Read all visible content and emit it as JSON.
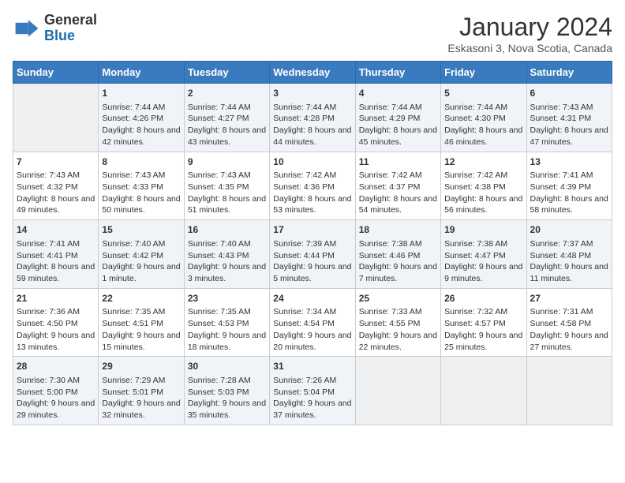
{
  "header": {
    "logo_line1": "General",
    "logo_line2": "Blue",
    "month": "January 2024",
    "location": "Eskasoni 3, Nova Scotia, Canada"
  },
  "days_of_week": [
    "Sunday",
    "Monday",
    "Tuesday",
    "Wednesday",
    "Thursday",
    "Friday",
    "Saturday"
  ],
  "weeks": [
    [
      {
        "day": "",
        "content": ""
      },
      {
        "day": "1",
        "content": "Sunrise: 7:44 AM\nSunset: 4:26 PM\nDaylight: 8 hours and 42 minutes."
      },
      {
        "day": "2",
        "content": "Sunrise: 7:44 AM\nSunset: 4:27 PM\nDaylight: 8 hours and 43 minutes."
      },
      {
        "day": "3",
        "content": "Sunrise: 7:44 AM\nSunset: 4:28 PM\nDaylight: 8 hours and 44 minutes."
      },
      {
        "day": "4",
        "content": "Sunrise: 7:44 AM\nSunset: 4:29 PM\nDaylight: 8 hours and 45 minutes."
      },
      {
        "day": "5",
        "content": "Sunrise: 7:44 AM\nSunset: 4:30 PM\nDaylight: 8 hours and 46 minutes."
      },
      {
        "day": "6",
        "content": "Sunrise: 7:43 AM\nSunset: 4:31 PM\nDaylight: 8 hours and 47 minutes."
      }
    ],
    [
      {
        "day": "7",
        "content": "Sunrise: 7:43 AM\nSunset: 4:32 PM\nDaylight: 8 hours and 49 minutes."
      },
      {
        "day": "8",
        "content": "Sunrise: 7:43 AM\nSunset: 4:33 PM\nDaylight: 8 hours and 50 minutes."
      },
      {
        "day": "9",
        "content": "Sunrise: 7:43 AM\nSunset: 4:35 PM\nDaylight: 8 hours and 51 minutes."
      },
      {
        "day": "10",
        "content": "Sunrise: 7:42 AM\nSunset: 4:36 PM\nDaylight: 8 hours and 53 minutes."
      },
      {
        "day": "11",
        "content": "Sunrise: 7:42 AM\nSunset: 4:37 PM\nDaylight: 8 hours and 54 minutes."
      },
      {
        "day": "12",
        "content": "Sunrise: 7:42 AM\nSunset: 4:38 PM\nDaylight: 8 hours and 56 minutes."
      },
      {
        "day": "13",
        "content": "Sunrise: 7:41 AM\nSunset: 4:39 PM\nDaylight: 8 hours and 58 minutes."
      }
    ],
    [
      {
        "day": "14",
        "content": "Sunrise: 7:41 AM\nSunset: 4:41 PM\nDaylight: 8 hours and 59 minutes."
      },
      {
        "day": "15",
        "content": "Sunrise: 7:40 AM\nSunset: 4:42 PM\nDaylight: 9 hours and 1 minute."
      },
      {
        "day": "16",
        "content": "Sunrise: 7:40 AM\nSunset: 4:43 PM\nDaylight: 9 hours and 3 minutes."
      },
      {
        "day": "17",
        "content": "Sunrise: 7:39 AM\nSunset: 4:44 PM\nDaylight: 9 hours and 5 minutes."
      },
      {
        "day": "18",
        "content": "Sunrise: 7:38 AM\nSunset: 4:46 PM\nDaylight: 9 hours and 7 minutes."
      },
      {
        "day": "19",
        "content": "Sunrise: 7:38 AM\nSunset: 4:47 PM\nDaylight: 9 hours and 9 minutes."
      },
      {
        "day": "20",
        "content": "Sunrise: 7:37 AM\nSunset: 4:48 PM\nDaylight: 9 hours and 11 minutes."
      }
    ],
    [
      {
        "day": "21",
        "content": "Sunrise: 7:36 AM\nSunset: 4:50 PM\nDaylight: 9 hours and 13 minutes."
      },
      {
        "day": "22",
        "content": "Sunrise: 7:35 AM\nSunset: 4:51 PM\nDaylight: 9 hours and 15 minutes."
      },
      {
        "day": "23",
        "content": "Sunrise: 7:35 AM\nSunset: 4:53 PM\nDaylight: 9 hours and 18 minutes."
      },
      {
        "day": "24",
        "content": "Sunrise: 7:34 AM\nSunset: 4:54 PM\nDaylight: 9 hours and 20 minutes."
      },
      {
        "day": "25",
        "content": "Sunrise: 7:33 AM\nSunset: 4:55 PM\nDaylight: 9 hours and 22 minutes."
      },
      {
        "day": "26",
        "content": "Sunrise: 7:32 AM\nSunset: 4:57 PM\nDaylight: 9 hours and 25 minutes."
      },
      {
        "day": "27",
        "content": "Sunrise: 7:31 AM\nSunset: 4:58 PM\nDaylight: 9 hours and 27 minutes."
      }
    ],
    [
      {
        "day": "28",
        "content": "Sunrise: 7:30 AM\nSunset: 5:00 PM\nDaylight: 9 hours and 29 minutes."
      },
      {
        "day": "29",
        "content": "Sunrise: 7:29 AM\nSunset: 5:01 PM\nDaylight: 9 hours and 32 minutes."
      },
      {
        "day": "30",
        "content": "Sunrise: 7:28 AM\nSunset: 5:03 PM\nDaylight: 9 hours and 35 minutes."
      },
      {
        "day": "31",
        "content": "Sunrise: 7:26 AM\nSunset: 5:04 PM\nDaylight: 9 hours and 37 minutes."
      },
      {
        "day": "",
        "content": ""
      },
      {
        "day": "",
        "content": ""
      },
      {
        "day": "",
        "content": ""
      }
    ]
  ]
}
